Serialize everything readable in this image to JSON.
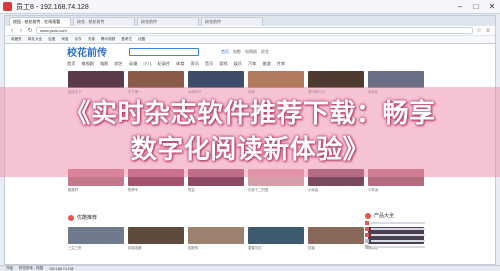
{
  "window": {
    "title": "员工8 - 192.168.74.128"
  },
  "browser": {
    "tabs": [
      "校园 - 校花前传 - 在线观看",
      "校花 - 校花前传",
      "校花前传",
      "校花前传"
    ],
    "address": "www.ysdu.com",
    "bookmarks": [
      "收藏夹",
      "网址大全",
      "百度",
      "淘宝",
      "京东",
      "天猫",
      "腾讯视频",
      "爱奇艺",
      "优酷"
    ]
  },
  "site": {
    "logo": "校花前传",
    "tabs": [
      "首页",
      "电影",
      "电视剧",
      "综艺"
    ],
    "nav": [
      "首页",
      "电视剧",
      "电影",
      "综艺",
      "动漫",
      "少儿",
      "纪录片",
      "体育",
      "资讯",
      "音乐",
      "游戏",
      "娱乐",
      "汽车",
      "旅游",
      "片库"
    ],
    "captions_row1": [
      "独步天下",
      "天下第一",
      "大明风华",
      "将夜",
      "雪中悍刀行",
      "庆余年"
    ],
    "captions_row2": [
      "都挺好",
      "陈情令",
      "知否",
      "长安十二时辰",
      "小欢喜",
      "少年派"
    ],
    "captions_row3": [
      "三生三世",
      "延禧攻略",
      "如懿传",
      "香蜜沉沉",
      "扶摇",
      "琅琊榜"
    ],
    "section_title": "优酷推荐",
    "side_title": "产品大全"
  },
  "headline": {
    "line1": "《实时杂志软件推荐下载：畅享",
    "line2": "数字化阅读新体验》"
  },
  "taskbar": {
    "items": [
      "开始",
      "校花前传 - 校园",
      "192.168.74.128"
    ]
  },
  "colors": {
    "accent": "#2c6fd1",
    "overlay": "#ee8caa",
    "hot": "#e8554f"
  }
}
